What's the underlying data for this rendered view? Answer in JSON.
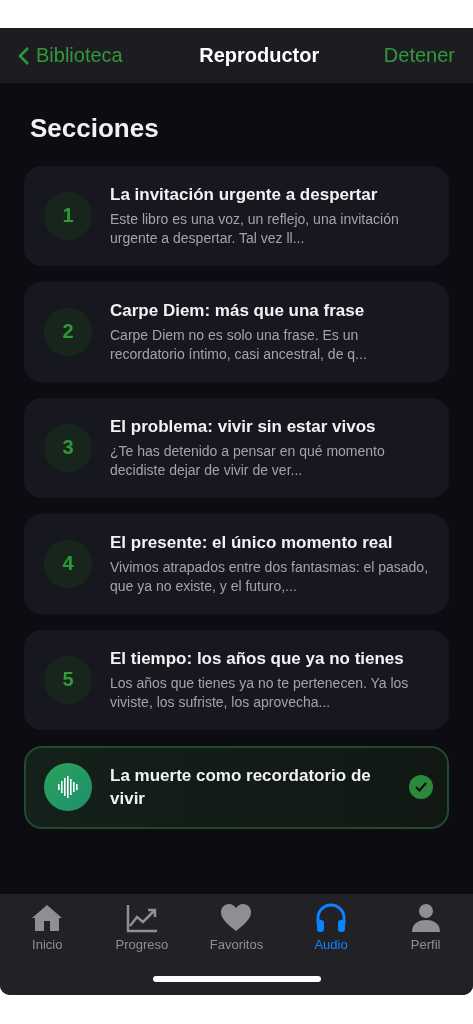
{
  "nav": {
    "back": "Biblioteca",
    "title": "Reproductor",
    "action": "Detener"
  },
  "heading": "Secciones",
  "sections": [
    {
      "number": "1",
      "title": "La invitación urgente a despertar",
      "summary": "Este libro es una voz, un reflejo, una invitación urgente a despertar. Tal vez ll...",
      "selected": false,
      "completed": false
    },
    {
      "number": "2",
      "title": "Carpe Diem: más que una frase",
      "summary": "Carpe Diem no es solo una frase. Es un recordatorio íntimo, casi ancestral, de q...",
      "selected": false,
      "completed": false
    },
    {
      "number": "3",
      "title": "El problema: vivir sin estar vivos",
      "summary": "¿Te has detenido a pensar en qué momento decidiste dejar de vivir de ver...",
      "selected": false,
      "completed": false
    },
    {
      "number": "4",
      "title": "El presente: el único momento real",
      "summary": "Vivimos atrapados entre dos fantasmas: el pasado, que ya no existe, y el futuro,...",
      "selected": false,
      "completed": false
    },
    {
      "number": "5",
      "title": "El tiempo: los años que ya no tienes",
      "summary": "Los años que tienes ya no te pertenecen. Ya los viviste, los sufriste, los aprovecha...",
      "selected": false,
      "completed": false
    },
    {
      "title": "La muerte como recordatorio de vivir",
      "selected": true,
      "completed": true
    }
  ],
  "tabs": [
    {
      "kind": "home",
      "label": "Inicio",
      "selected": false
    },
    {
      "kind": "progress",
      "label": "Progreso",
      "selected": false
    },
    {
      "kind": "favorites",
      "label": "Favoritos",
      "selected": false
    },
    {
      "kind": "audio",
      "label": "Audio",
      "selected": true
    },
    {
      "kind": "profile",
      "label": "Perfil",
      "selected": false
    }
  ]
}
